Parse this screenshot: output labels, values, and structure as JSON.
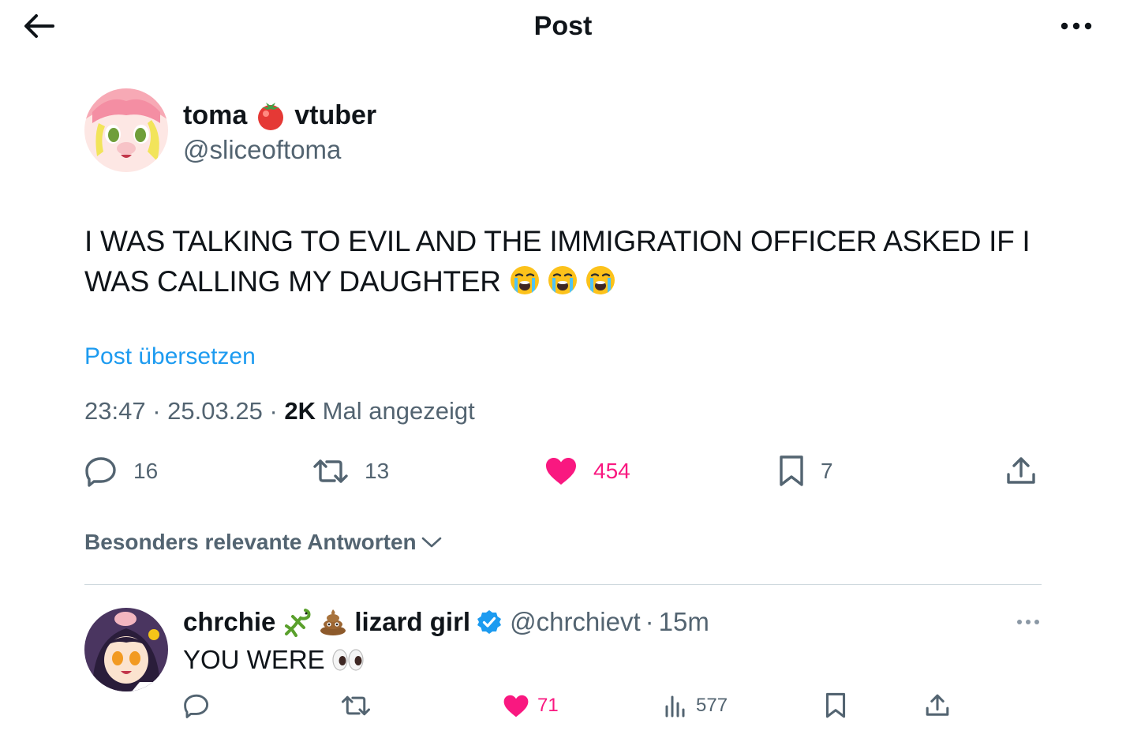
{
  "header": {
    "title": "Post",
    "back_icon": "arrow-left-icon",
    "more_icon": "more-horizontal-icon"
  },
  "post": {
    "author": {
      "name_part1": "toma",
      "name_emoji": "tomato-emoji",
      "name_part2": "vtuber",
      "handle": "@sliceoftoma"
    },
    "text": "I WAS TALKING TO EVIL AND THE IMMIGRATION OFFICER ASKED IF I WAS CALLING MY DAUGHTER",
    "text_emojis": [
      "loudly-crying-face",
      "loudly-crying-face",
      "loudly-crying-face"
    ],
    "translate_label": "Post übersetzen",
    "time": "23:47",
    "date": "25.03.25",
    "views_count": "2K",
    "views_label": "Mal angezeigt",
    "separator": "·",
    "stats": {
      "replies": "16",
      "reposts": "13",
      "likes": "454",
      "bookmarks": "7"
    }
  },
  "sort_label": "Besonders relevante Antworten",
  "reply": {
    "name_part1": "chrchie",
    "name_part2": "lizard girl",
    "name_emojis": [
      "lizard-emoji",
      "pile-of-poo-emoji"
    ],
    "verified": true,
    "handle": "@chrchievt",
    "time": "15m",
    "separator": "·",
    "text": "YOU WERE",
    "text_emoji": "eyes-emoji",
    "stats": {
      "likes": "71",
      "views": "577"
    }
  },
  "colors": {
    "accent": "#1d9bf0",
    "like": "#f91880",
    "secondary_text": "#536471",
    "divider": "#cfd9de"
  }
}
